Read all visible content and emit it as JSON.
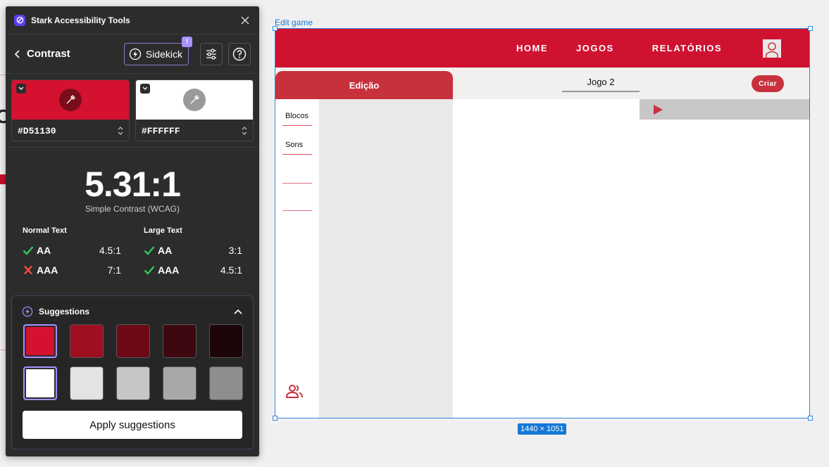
{
  "plugin": {
    "title": "Stark Accessibility Tools",
    "section": "Contrast",
    "sidekick_label": "Sidekick",
    "sidekick_badge": "!",
    "foreground": {
      "hex": "#D51130",
      "color": "#D51130"
    },
    "background": {
      "hex": "#FFFFFF",
      "color": "#FFFFFF"
    },
    "ratio": "5.31:1",
    "ratio_label": "Simple Contrast (WCAG)",
    "normal_text": {
      "heading": "Normal Text",
      "aa": {
        "label": "AA",
        "value": "4.5:1",
        "pass": true
      },
      "aaa": {
        "label": "AAA",
        "value": "7:1",
        "pass": false
      }
    },
    "large_text": {
      "heading": "Large Text",
      "aa": {
        "label": "AA",
        "value": "3:1",
        "pass": true
      },
      "aaa": {
        "label": "AAA",
        "value": "4.5:1",
        "pass": true
      }
    },
    "suggestions": {
      "title": "Suggestions",
      "foreground_options": [
        "#D51130",
        "#9E0F21",
        "#6E0A17",
        "#3E0811",
        "#1C0508"
      ],
      "background_options": [
        "#FFFFFF",
        "#E3E3E3",
        "#C6C6C6",
        "#A8A8A8",
        "#8E8E8E"
      ],
      "apply_label": "Apply suggestions"
    }
  },
  "canvas": {
    "frame_label": "Edit game",
    "dimensions": "1440 × 1051",
    "nav": [
      "HOME",
      "JOGOS",
      "RELATÓRIOS"
    ],
    "tab_label": "Edição",
    "game_name": "Jogo 2",
    "create_label": "Criar",
    "sidebar_items": [
      "Blocos",
      "Sons"
    ],
    "colors": {
      "brand_red": "#D01231",
      "accent_red": "#C8313C"
    }
  }
}
